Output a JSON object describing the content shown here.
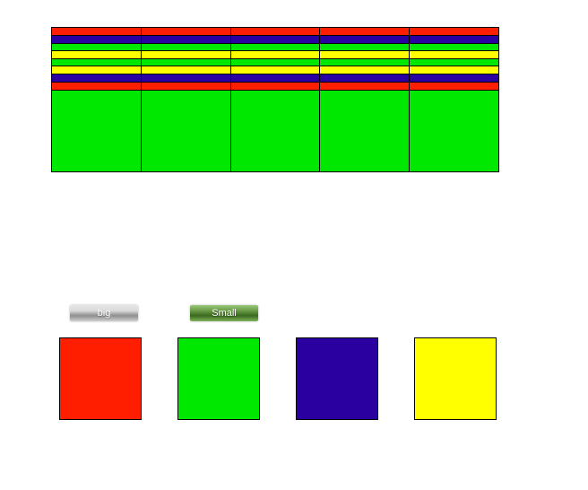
{
  "grid": {
    "columns": 5,
    "rows": [
      {
        "color": "red",
        "h": 8
      },
      {
        "color": "blue",
        "h": 8
      },
      {
        "color": "green",
        "h": 7
      },
      {
        "color": "yellow",
        "h": 8
      },
      {
        "color": "green",
        "h": 7
      },
      {
        "color": "yellow",
        "h": 8
      },
      {
        "color": "blue",
        "h": 8
      },
      {
        "color": "red",
        "h": 8
      },
      {
        "color": "green",
        "h": 90
      }
    ]
  },
  "buttons": {
    "big": {
      "label": "big",
      "style": "grey"
    },
    "small": {
      "label": "Small",
      "style": "greenb"
    }
  },
  "swatches": [
    {
      "name": "red",
      "color": "#ff1e00"
    },
    {
      "name": "green",
      "color": "#00e800"
    },
    {
      "name": "blue",
      "color": "#2a00a0"
    },
    {
      "name": "yellow",
      "color": "#ffff00"
    }
  ]
}
